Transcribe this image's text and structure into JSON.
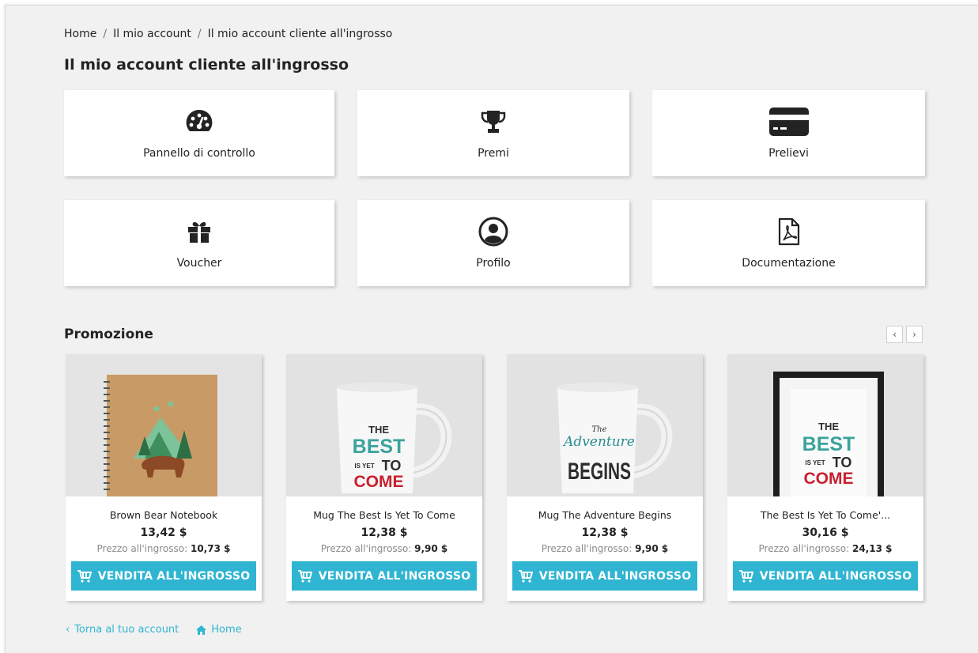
{
  "breadcrumb": {
    "items": [
      "Home",
      "Il mio account",
      "Il mio account cliente all'ingrosso"
    ],
    "separator": "/"
  },
  "page": {
    "title": "Il mio account cliente all'ingrosso"
  },
  "tiles": [
    {
      "label": "Pannello di controllo",
      "icon": "dashboard-icon"
    },
    {
      "label": "Premi",
      "icon": "trophy-icon"
    },
    {
      "label": "Prelievi",
      "icon": "credit-card-icon"
    },
    {
      "label": "Voucher",
      "icon": "gift-icon"
    },
    {
      "label": "Profilo",
      "icon": "user-circle-icon"
    },
    {
      "label": "Documentazione",
      "icon": "pdf-file-icon"
    }
  ],
  "promo": {
    "title": "Promozione",
    "prev": "‹",
    "next": "›",
    "products": [
      {
        "name": "Brown Bear Notebook",
        "price": "13,42 $",
        "wholesale_label": "Prezzo all'ingrosso:",
        "wholesale_price": "10,73 $",
        "button": "VENDITA ALL'INGROSSO"
      },
      {
        "name": "Mug The Best Is Yet To Come",
        "price": "12,38 $",
        "wholesale_label": "Prezzo all'ingrosso:",
        "wholesale_price": "9,90 $",
        "button": "VENDITA ALL'INGROSSO"
      },
      {
        "name": "Mug The Adventure Begins",
        "price": "12,38 $",
        "wholesale_label": "Prezzo all'ingrosso:",
        "wholesale_price": "9,90 $",
        "button": "VENDITA ALL'INGROSSO"
      },
      {
        "name": "The Best Is Yet To Come'...",
        "price": "30,16 $",
        "wholesale_label": "Prezzo all'ingrosso:",
        "wholesale_price": "24,13 $",
        "button": "VENDITA ALL'INGROSSO"
      }
    ],
    "image_text": {
      "mug1": {
        "the": "THE",
        "best": "BEST",
        "is_yet": "IS YET",
        "to": "TO",
        "come": "COME"
      },
      "mug2": {
        "the": "The",
        "adventure": "Adventure",
        "begins": "BEGINS"
      },
      "poster": {
        "the": "THE",
        "best": "BEST",
        "is_yet": "IS YET",
        "to": "TO",
        "come": "COME"
      }
    }
  },
  "footer": {
    "back": "Torna al tuo account",
    "home": "Home"
  },
  "colors": {
    "accent": "#2fb5d2",
    "background": "#f1f1f1",
    "text": "#232323"
  }
}
